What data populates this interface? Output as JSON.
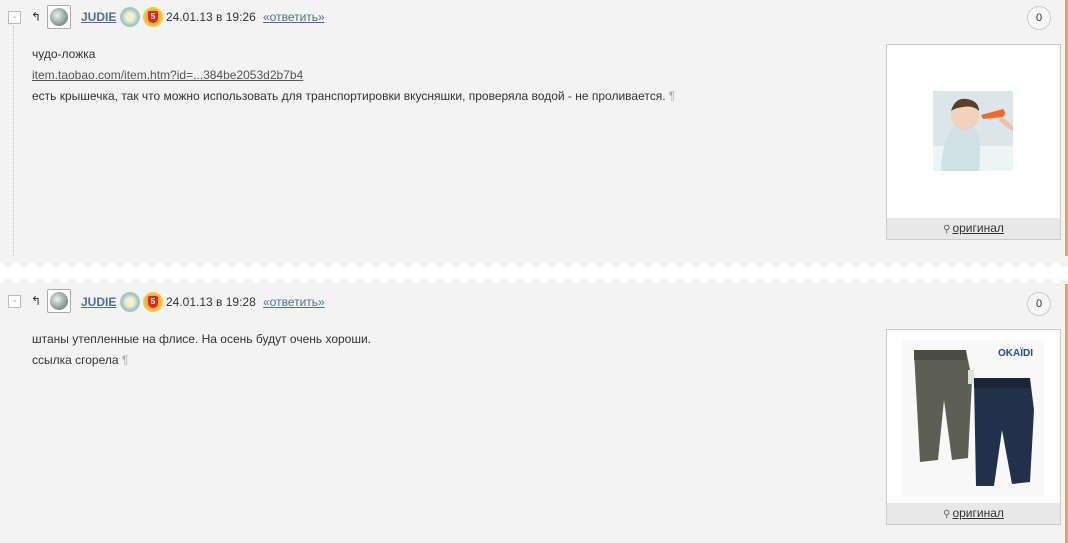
{
  "comments": [
    {
      "author": "JUDIE",
      "date": "24.01.13 в 19:26",
      "reply_label": "«ответить»",
      "count": "0",
      "collapse": "-",
      "lines": [
        "чудо-ложка",
        "item.taobao.com/item.htm?id=...384be2053d2b7b4",
        "есть крышечка, так что можно использовать для транспортировки вкусняшки, проверяла водой - не проливается."
      ],
      "pilcrow": "¶",
      "image_link": "оригинал"
    },
    {
      "author": "JUDIE",
      "date": "24.01.13 в 19:28",
      "reply_label": "«ответить»",
      "count": "0",
      "collapse": "-",
      "lines": [
        "штаны утепленные на флисе. На осень будут очень хороши.",
        "ссылка сгорела"
      ],
      "pilcrow": "¶",
      "image_link": "оригинал",
      "image_brand": "OKAÏDI"
    }
  ],
  "icons": {
    "reply_arrow": "↰",
    "magnifier": "⚲"
  },
  "colors": {
    "link": "#4d6e9c",
    "accent_edge": "#f0a830",
    "background": "#f3f3f3"
  }
}
